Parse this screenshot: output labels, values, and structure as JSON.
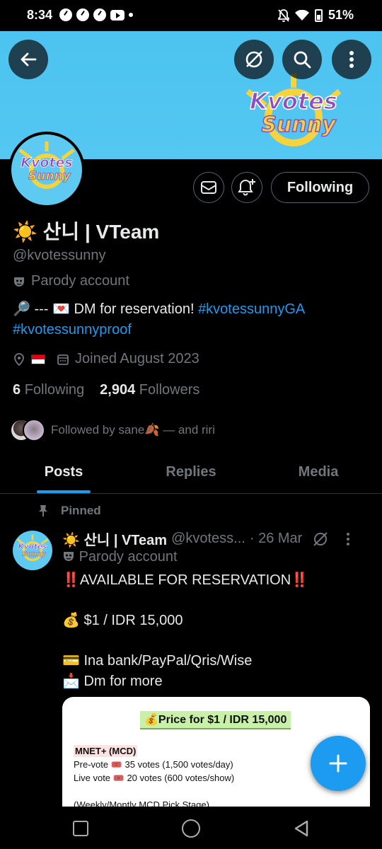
{
  "status_bar": {
    "time": "8:34",
    "battery": "51%"
  },
  "banner": {
    "logo_text_1": "Kvotes",
    "logo_text_2": "Sunny"
  },
  "profile": {
    "display_name": "☀️ 산니 | VTeam",
    "handle": "@kvotessunny",
    "parody_label": "Parody account",
    "bio_prefix": "🔎 --- 💌 DM for reservation! ",
    "bio_tag1": "#kvotessunnyGA",
    "bio_tag2": "#kvotessunnyproof",
    "joined": "Joined August 2023",
    "following_count": "6",
    "following_label": "Following",
    "followers_count": "2,904",
    "followers_label": "Followers",
    "followed_by": "Followed by sane🍂 — and riri",
    "following_button": "Following"
  },
  "tabs": [
    "Posts",
    "Replies",
    "Media"
  ],
  "post": {
    "pinned_label": "Pinned",
    "name": "☀️ 산니 | VTeam",
    "handle": "@kvotess...",
    "date": "· 26 Mar",
    "parody_label": "Parody account",
    "lines": [
      "‼️AVAILABLE FOR RESERVATION‼️",
      "",
      "💰 $1 / IDR 15,000",
      "",
      "💳 Ina bank/PayPal/Qris/Wise",
      "📩 Dm for more"
    ],
    "image": {
      "title": "💰Price for $1 / IDR 15,000",
      "section": "MNET+ (MCD)",
      "line1": "Pre-vote 🎟️ 35 votes (1,500 votes/day)",
      "line2": "Live vote 🎟️ 20 votes (600 votes/show)",
      "line3": "(Weekly/Montly MCD Pick Stage)"
    }
  },
  "icons": {
    "back": "arrow-left-icon",
    "grok": "grok-icon",
    "search": "search-icon",
    "more": "more-vertical-icon",
    "mail": "mail-icon",
    "notify": "bell-plus-icon",
    "pin": "pin-icon",
    "location": "location-icon",
    "calendar": "calendar-icon",
    "compose": "plus-icon"
  },
  "colors": {
    "accent": "#1d9bf0",
    "banner": "#4cc3f0",
    "muted": "#71767b"
  }
}
